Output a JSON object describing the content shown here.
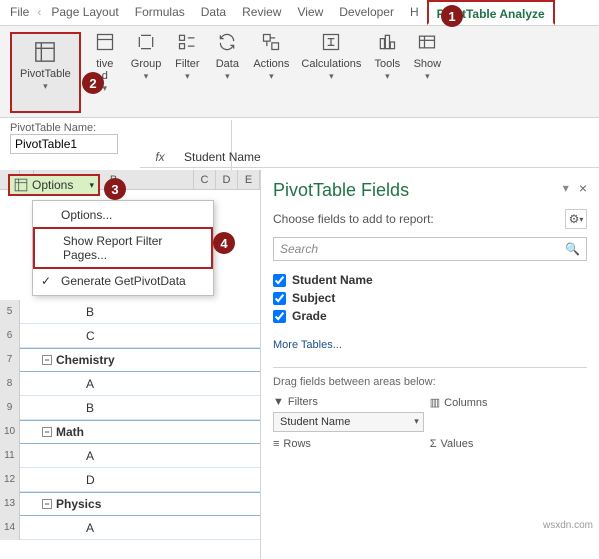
{
  "tabs": {
    "file": "File",
    "pagelayout": "Page Layout",
    "formulas": "Formulas",
    "data": "Data",
    "review": "Review",
    "view": "View",
    "developer": "Developer",
    "help_initial": "H",
    "pvt_analyze": "PivotTable Analyze"
  },
  "ribbon": {
    "pivottable": "PivotTable",
    "active_field": "tive\nd",
    "group": "Group",
    "filter": "Filter",
    "data": "Data",
    "actions": "Actions",
    "calculations": "Calculations",
    "tools": "Tools",
    "show": "Show"
  },
  "name_section": {
    "label": "PivotTable Name:",
    "value": "PivotTable1",
    "options_btn": "Options"
  },
  "formula_bar": {
    "fx": "fx",
    "value": "Student Name"
  },
  "context_menu": {
    "options": "Options...",
    "show_pages": "Show Report Filter Pages...",
    "gen_pivot": "Generate GetPivotData"
  },
  "grid": {
    "col_b": "B",
    "col_c": "C",
    "col_d": "D",
    "col_e": "E",
    "rows": {
      "r5": "B",
      "r6": "C",
      "r7_header": "Chemistry",
      "r8": "A",
      "r9": "B",
      "r10_header": "Math",
      "r11": "A",
      "r12": "D",
      "r13_header": "Physics",
      "r14": "A"
    }
  },
  "fields_pane": {
    "title": "PivotTable Fields",
    "subtitle": "Choose fields to add to report:",
    "search_placeholder": "Search",
    "fields": {
      "student": "Student Name",
      "subject": "Subject",
      "grade": "Grade"
    },
    "more_tables": "More Tables...",
    "drag_label": "Drag fields between areas below:",
    "filters_label": "Filters",
    "columns_label": "Columns",
    "rows_label": "Rows",
    "values_label": "Values",
    "filter_pill": "Student Name"
  },
  "watermark": "wsxdn.com"
}
